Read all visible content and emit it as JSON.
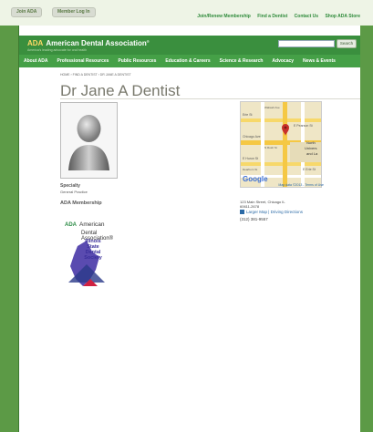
{
  "topbar": {
    "join_label": "Join ADA",
    "login_label": "Member Log In",
    "links": [
      "Join/Renew Membership",
      "Find a Dentist",
      "Contact Us",
      "Shop ADA Store"
    ]
  },
  "header": {
    "logo_abbr": "ADA",
    "logo_name": "American Dental Association",
    "logo_reg": "®",
    "tagline": "America's leading advocate for oral health",
    "search_button": "Search",
    "search_placeholder": ""
  },
  "nav": {
    "items": [
      "About ADA",
      "Professional Resources",
      "Public Resources",
      "Education & Careers",
      "Science & Research",
      "Advocacy",
      "News & Events"
    ]
  },
  "breadcrumb": {
    "home": "HOME",
    "find": "FIND A DENTIST",
    "current": "DR JANE A DENTIST",
    "separator": "›"
  },
  "profile": {
    "name": "Dr Jane A Dentist",
    "specialty_label": "Specialty",
    "specialty_value": "General Practice",
    "membership_label": "ADA Membership"
  },
  "ada_logo": {
    "abbr": "ADA",
    "line1": "American",
    "line2": "Dental",
    "line3": "Association®"
  },
  "isds_logo": {
    "line1": "Illinois",
    "line2": "State",
    "line3": "Dental",
    "line4": "Society"
  },
  "map": {
    "streets": [
      "Erie St",
      "E Huron St",
      "E Pearson St",
      "Chicago Ave",
      "N Rush St",
      "Wabash Ave",
      "E Erie St",
      "Dearborn St",
      "North",
      "Univers",
      "and La"
    ],
    "google_label": "Google",
    "footer": "Map data ©2013 - Terms of Use"
  },
  "address": {
    "line1": "123 Main Street, Chicago IL",
    "line2": "60611-2678",
    "map_links": "Larger Map | Driving Directions",
    "phone": "(312) 381-9557"
  },
  "colors": {
    "brand_green": "#3a8f3e",
    "nav_green": "#45a047",
    "link_blue": "#2b6aa6"
  }
}
